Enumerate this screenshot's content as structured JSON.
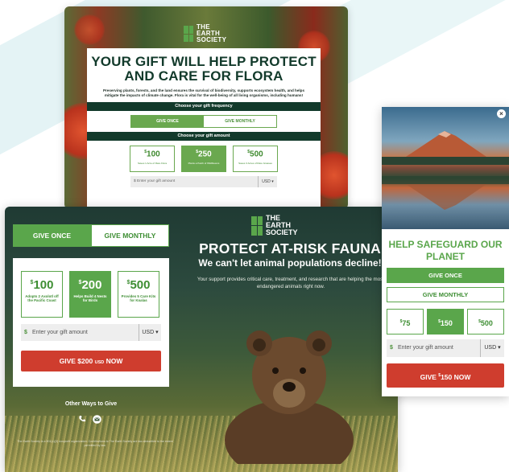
{
  "flora": {
    "logo": {
      "line1": "THE",
      "line2": "EARTH",
      "line3": "SOCIETY"
    },
    "title_line1": "YOUR GIFT WILL HELP PROTECT",
    "title_line2": "AND CARE FOR FLORA",
    "description": "Preserving plants, forests, and the land ensures the survival of biodiversity, supports ecosystem health, and helps mitigate the impacts of climate change. Flora is vital for the well-being of all living organisms, including humans!",
    "frequency_heading": "Choose your gift frequency",
    "give_once": "GIVE ONCE",
    "give_monthly": "GIVE MONTHLY",
    "amount_heading": "Choose your gift amount",
    "amounts": [
      {
        "value": "100",
        "desc": "Saves 1 Acre of Rare Flora"
      },
      {
        "value": "250",
        "desc": "Plants a Patch of Wildflowers"
      },
      {
        "value": "500",
        "desc": "Saves 3 Acres of Rare Grasses"
      }
    ],
    "amount_placeholder": "Enter your gift amount",
    "dollar": "$",
    "currency": "USD ▾"
  },
  "fauna": {
    "give_once": "GIVE ONCE",
    "give_monthly": "GIVE MONTHLY",
    "amounts": [
      {
        "value": "100",
        "desc": "Adopts 2 Axolotl off the Pacific Coast"
      },
      {
        "value": "200",
        "desc": "Helps Build 4 Nests for Birds"
      },
      {
        "value": "500",
        "desc": "Provides 5 Care Kits for Koalas"
      }
    ],
    "dollar": "$",
    "amount_placeholder": "Enter your gift amount",
    "currency": "USD ▾",
    "give_button_main": "GIVE $200",
    "give_button_small": "USD",
    "give_button_end": "NOW",
    "other_ways": "Other Ways to Give",
    "footer_note": "The Earth Society is a 501(c)(3) nonprofit organization. Contributions to The Earth Society are tax-deductible to the extent permitted by law.",
    "logo": {
      "line1": "THE",
      "line2": "EARTH",
      "line3": "SOCIETY"
    },
    "headline": "PROTECT AT-RISK FAUNA",
    "subheadline": "We can't let animal populations decline!",
    "support_text": "Your support provides critical care, treatment, and research that are helping the most endangered animals right now."
  },
  "planet": {
    "close": "×",
    "headline": "HELP SAFEGUARD OUR PLANET",
    "give_once": "GIVE ONCE",
    "give_monthly": "GIVE MONTHLY",
    "amounts": [
      "75",
      "150",
      "500"
    ],
    "dollar": "$",
    "amount_placeholder": "Enter your gift amount",
    "currency": "USD ▾",
    "give_button_main": "GIVE ",
    "give_button_amount": "150",
    "give_button_end": " NOW"
  },
  "colors": {
    "brand_green": "#5aa64b",
    "dark_green": "#123a2b",
    "cta_red": "#cf3d2e"
  }
}
